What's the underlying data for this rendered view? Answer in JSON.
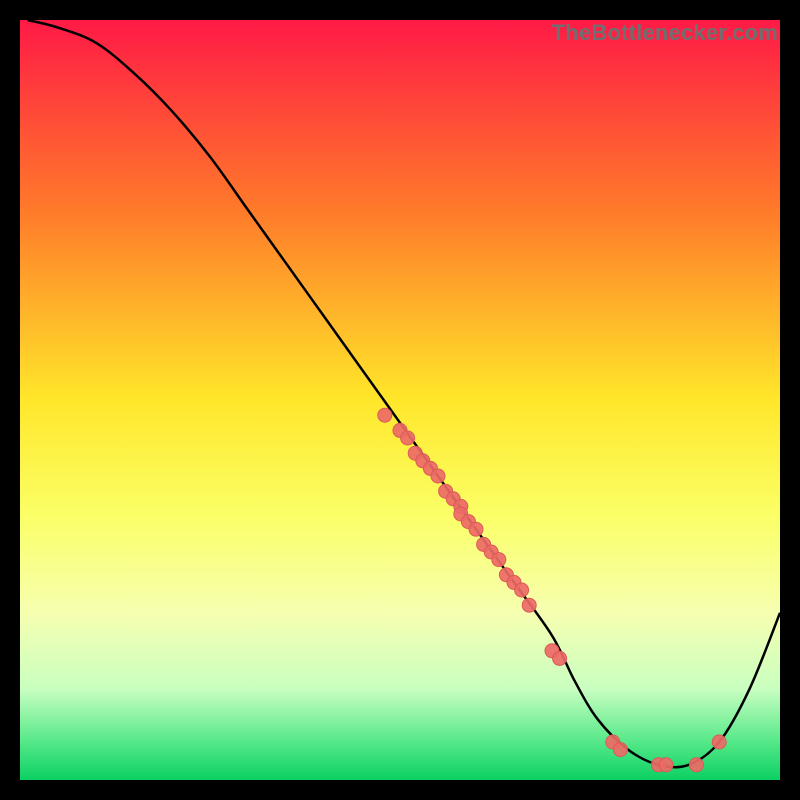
{
  "watermark": {
    "text": "TheBottlenecker.com"
  },
  "chart_data": {
    "type": "line",
    "title": "",
    "xlabel": "",
    "ylabel": "",
    "xlim": [
      0,
      100
    ],
    "ylim": [
      0,
      100
    ],
    "grid": false,
    "background_gradient": {
      "stops": [
        {
          "offset": 0.0,
          "color": "#ff1a46"
        },
        {
          "offset": 0.25,
          "color": "#ff7a2a"
        },
        {
          "offset": 0.5,
          "color": "#ffe72a"
        },
        {
          "offset": 0.65,
          "color": "#fbff66"
        },
        {
          "offset": 0.78,
          "color": "#f6ffb0"
        },
        {
          "offset": 0.88,
          "color": "#c9ffc0"
        },
        {
          "offset": 0.95,
          "color": "#55e889"
        },
        {
          "offset": 1.0,
          "color": "#0bd063"
        }
      ]
    },
    "curve": {
      "x": [
        1,
        5,
        10,
        15,
        20,
        25,
        30,
        35,
        40,
        45,
        50,
        55,
        60,
        65,
        70,
        73,
        76,
        80,
        84,
        88,
        92,
        96,
        100
      ],
      "y": [
        100,
        99,
        97,
        93,
        88,
        82,
        75,
        68,
        61,
        54,
        47,
        40,
        33,
        26,
        19,
        13,
        8,
        4,
        2,
        2,
        5,
        12,
        22
      ]
    },
    "scatter": {
      "x": [
        48,
        50,
        51,
        52,
        53,
        54,
        55,
        56,
        57,
        58,
        58,
        59,
        60,
        61,
        62,
        63,
        64,
        65,
        66,
        67,
        70,
        71,
        78,
        79,
        84,
        85,
        89,
        92
      ],
      "y": [
        48,
        46,
        45,
        43,
        42,
        41,
        40,
        38,
        37,
        36,
        35,
        34,
        33,
        31,
        30,
        29,
        27,
        26,
        25,
        23,
        17,
        16,
        5,
        4,
        2,
        2,
        2,
        5
      ],
      "color": "#ed6a66",
      "border": "#db5a56",
      "radius": 7
    }
  }
}
